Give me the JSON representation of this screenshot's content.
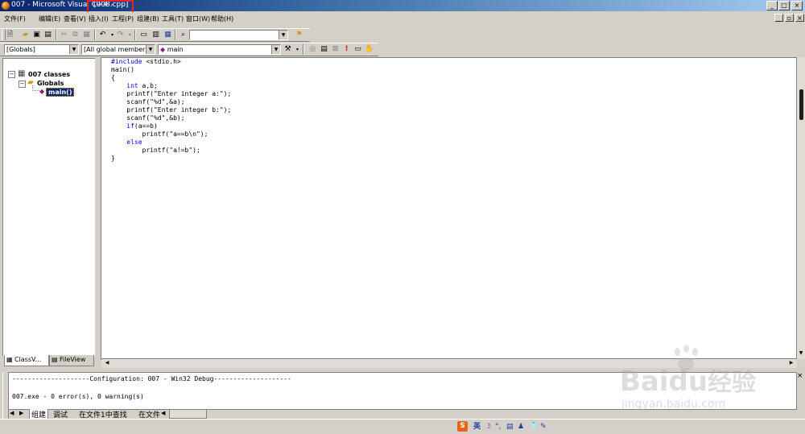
{
  "window": {
    "title": "007 - Microsoft Visual C++ - ",
    "file_label": "[008.cpp]"
  },
  "menubar": {
    "items": [
      "文件(F)",
      "编辑(E)",
      "查看(V)",
      "插入(I)",
      "工程(P)",
      "组建(B)",
      "工具(T)",
      "窗口(W)",
      "帮助(H)"
    ]
  },
  "toolbar": {
    "find_value": ""
  },
  "wizardbar": {
    "class_combo": "[Globals]",
    "filter_combo": "[All global members",
    "member_combo": "main"
  },
  "tree": {
    "root": "007 classes",
    "folder": "Globals",
    "function": "main()"
  },
  "left_tabs": {
    "classview": "ClassV...",
    "fileview": "FileView"
  },
  "editor": {
    "lines": [
      {
        "kw": "#include",
        "rest": " <stdio.h>"
      },
      {
        "kw": "",
        "rest": "main()"
      },
      {
        "kw": "",
        "rest": "{"
      },
      {
        "kw": "    int",
        "rest": " a,b;"
      },
      {
        "kw": "",
        "rest": "    printf(\"Enter integer a:\");"
      },
      {
        "kw": "",
        "rest": "    scanf(\"%d\",&a);"
      },
      {
        "kw": "",
        "rest": "    printf(\"Enter integer b:\");"
      },
      {
        "kw": "",
        "rest": "    scanf(\"%d\",&b);"
      },
      {
        "kw": "    if",
        "rest": "(a==b)"
      },
      {
        "kw": "",
        "rest": "        printf(\"a==b\\n\");"
      },
      {
        "kw": "    else",
        "rest": ""
      },
      {
        "kw": "",
        "rest": "        printf(\"a!=b\");"
      },
      {
        "kw": "",
        "rest": "}"
      }
    ]
  },
  "output": {
    "config_line": "--------------------Configuration: 007 - Win32 Debug--------------------",
    "result_line": "007.exe - 0 error(s), 0 warning(s)",
    "tabs": [
      "组建",
      "调试",
      "在文件1中查找",
      "在文件"
    ]
  },
  "statusbar": {
    "ime_lang": "英"
  },
  "watermark": {
    "brand": "Baidu",
    "brand_cn": "经验",
    "url": "jingyan.baidu.com"
  },
  "colors": {
    "title_bar": "#0a246a",
    "highlight_box": "#e0262b",
    "keyword": "#0000ff",
    "selection": "#0a246a"
  }
}
